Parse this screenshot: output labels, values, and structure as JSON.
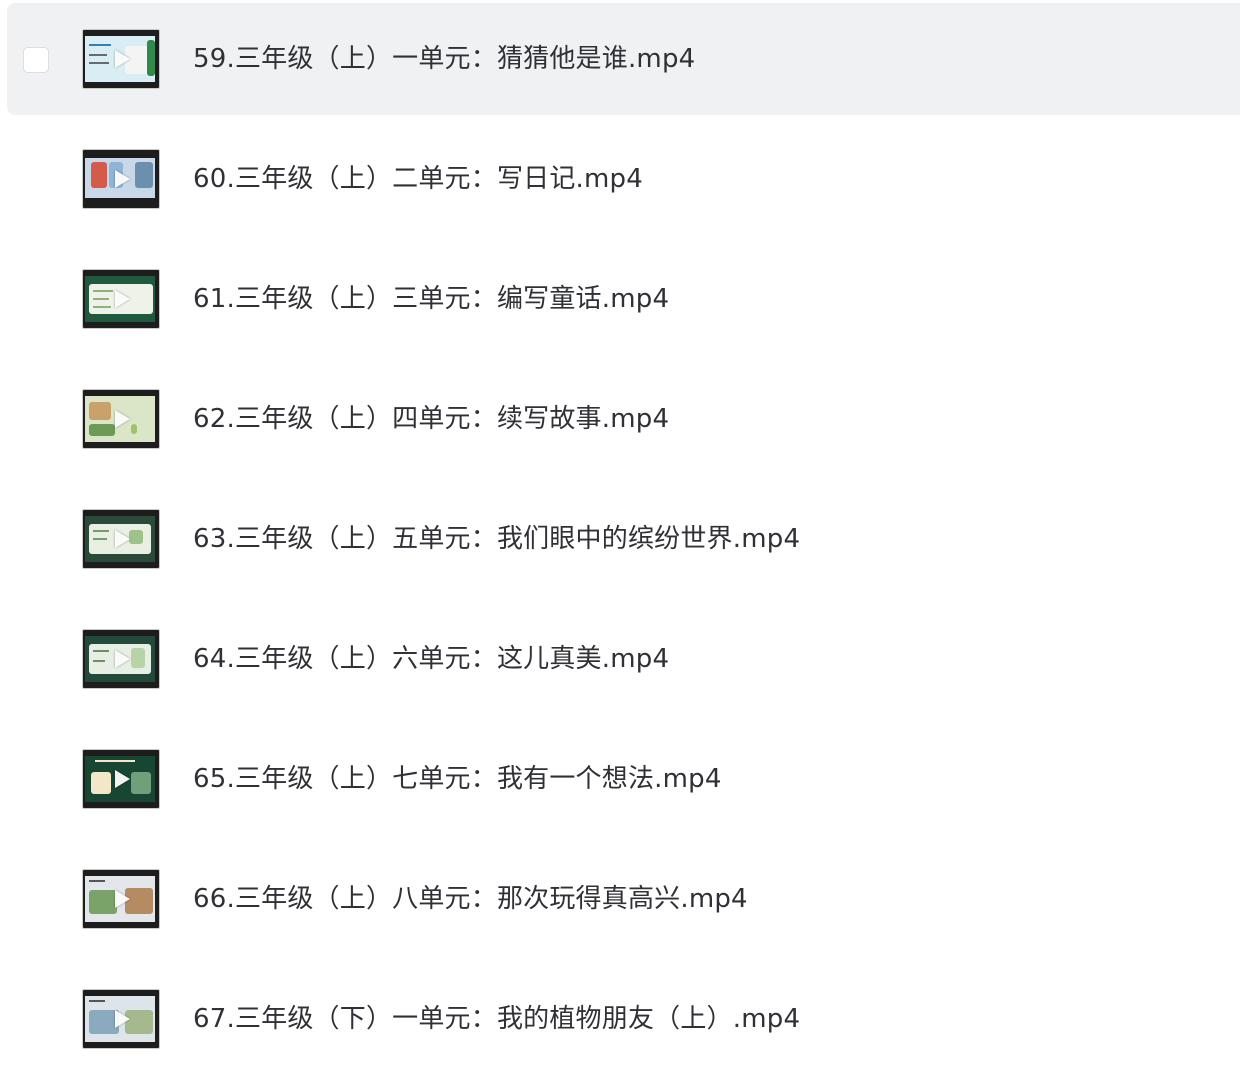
{
  "files": [
    {
      "name": "59.三年级（上）一单元：猜猜他是谁.mp4",
      "selected_hover": true,
      "thumb_colors": [
        "#d8eef4",
        "#7cc6e0",
        "#e6b24a"
      ],
      "play_icon": "play-icon"
    },
    {
      "name": "60.三年级（上）二单元：写日记.mp4",
      "selected_hover": false,
      "thumb_colors": [
        "#8fb4d6",
        "#c9d8e8",
        "#d35b4a"
      ],
      "play_icon": "play-icon"
    },
    {
      "name": "61.三年级（上）三单元：编写童话.mp4",
      "selected_hover": false,
      "thumb_colors": [
        "#1f5a3e",
        "#eef2e8",
        "#8fb27a"
      ],
      "play_icon": "play-icon"
    },
    {
      "name": "62.三年级（上）四单元：续写故事.mp4",
      "selected_hover": false,
      "thumb_colors": [
        "#dbe6c8",
        "#c9a26b",
        "#6e9a58"
      ],
      "play_icon": "play-icon"
    },
    {
      "name": "63.三年级（上）五单元：我们眼中的缤纷世界.mp4",
      "selected_hover": false,
      "thumb_colors": [
        "#2a4a3a",
        "#e9efe3",
        "#9fc28a"
      ],
      "play_icon": "play-icon"
    },
    {
      "name": "64.三年级（上）六单元：这儿真美.mp4",
      "selected_hover": false,
      "thumb_colors": [
        "#23493a",
        "#e7eee4",
        "#b9d3a8"
      ],
      "play_icon": "play-icon"
    },
    {
      "name": "65.三年级（上）七单元：我有一个想法.mp4",
      "selected_hover": false,
      "thumb_colors": [
        "#174733",
        "#f2e7c9",
        "#6fa07b"
      ],
      "play_icon": "play-icon"
    },
    {
      "name": "66.三年级（上）八单元：那次玩得真高兴.mp4",
      "selected_hover": false,
      "thumb_colors": [
        "#e3e6ea",
        "#7aa36a",
        "#b58b63"
      ],
      "play_icon": "play-icon"
    },
    {
      "name": "67.三年级（下）一单元：我的植物朋友（上）.mp4",
      "selected_hover": false,
      "thumb_colors": [
        "#dde5ea",
        "#8aaabd",
        "#a6b98e"
      ],
      "play_icon": "play-icon"
    }
  ]
}
